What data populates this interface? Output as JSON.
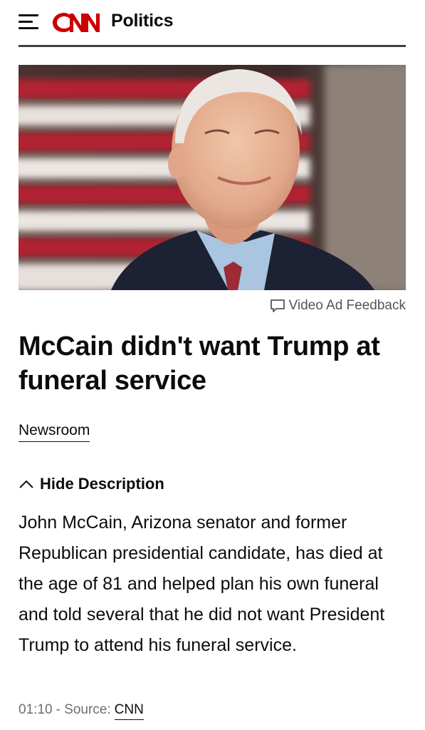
{
  "header": {
    "logo_text": "CNN",
    "section": "Politics"
  },
  "colors": {
    "brand_red": "#cc0000",
    "text": "#0c0c0c",
    "muted": "#6e6e6e"
  },
  "video": {
    "ad_feedback": "Video Ad Feedback",
    "headline": "McCain didn't want Trump at funeral service",
    "byline": "Newsroom",
    "description_toggle": "Hide Description",
    "description": "John McCain, Arizona senator and former Republican presidential candidate, has died at the age of 81 and helped plan his own funeral and told several that he did not want President Trump to attend his funeral service.",
    "duration": "01:10",
    "source_separator": "- Source:",
    "source": "CNN"
  },
  "icons": {
    "menu": "hamburger-menu-icon",
    "feedback": "comment-bubble-icon",
    "toggle": "chevron-up-icon"
  }
}
